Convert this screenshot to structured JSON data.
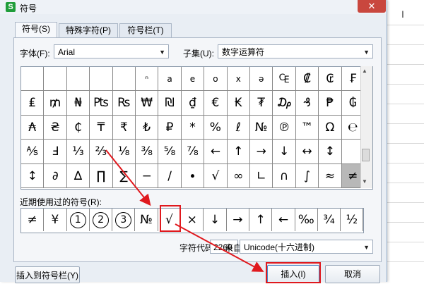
{
  "window": {
    "title": "符号",
    "app_logo": "S",
    "close_glyph": "✕"
  },
  "tabs": [
    {
      "label": "符号(S)",
      "active": true
    },
    {
      "label": "特殊字符(P)",
      "active": false
    },
    {
      "label": "符号栏(T)",
      "active": false
    }
  ],
  "font": {
    "label": "字体(F):",
    "value": "Arial"
  },
  "subset": {
    "label": "子集(U):",
    "value": "数字运算符"
  },
  "grid": {
    "rows": [
      [
        "",
        "",
        "",
        "",
        "",
        "ⁿ",
        "a",
        "e",
        "o",
        "x",
        "ə",
        "₠",
        "₡",
        "₢",
        "₣"
      ],
      [
        "₤",
        "₥",
        "₦",
        "₧",
        "₨",
        "₩",
        "₪",
        "₫",
        "€",
        "₭",
        "₮",
        "₯",
        "₰",
        "₱",
        "₲"
      ],
      [
        "₳",
        "₴",
        "₵",
        "₸",
        "₹",
        "₺",
        "₽",
        "*",
        "%",
        "ℓ",
        "№",
        "℗",
        "™",
        "Ω",
        "℮"
      ],
      [
        "⅍",
        "Ⅎ",
        "⅓",
        "⅔",
        "⅛",
        "⅜",
        "⅝",
        "⅞",
        "←",
        "↑",
        "→",
        "↓",
        "↔",
        "↕",
        ""
      ],
      [
        "↕",
        "∂",
        "∆",
        "∏",
        "∑",
        "−",
        "∕",
        "∙",
        "√",
        "∞",
        "∟",
        "∩",
        "∫",
        "≈",
        "≠"
      ]
    ],
    "selected": "≠"
  },
  "recent": {
    "label": "近期使用过的符号(R):",
    "items": [
      "≠",
      "¥",
      "①",
      "②",
      "③",
      "№",
      "√",
      "×",
      "↓",
      "→",
      "↑",
      "←",
      "‰",
      "¾",
      "½"
    ]
  },
  "char_code": {
    "label": "字符代码(C):",
    "value": "2260",
    "from_label": "来自(M)",
    "from_value": "Unicode(十六进制)"
  },
  "buttons": {
    "insert_to_bar": "插入到符号栏(Y)",
    "insert": "插入(I)",
    "cancel": "取消"
  },
  "colors": {
    "annotation": "#e0191e",
    "selected_cell": "#b8b8b8",
    "dialog_bg": "#e9eef4"
  }
}
